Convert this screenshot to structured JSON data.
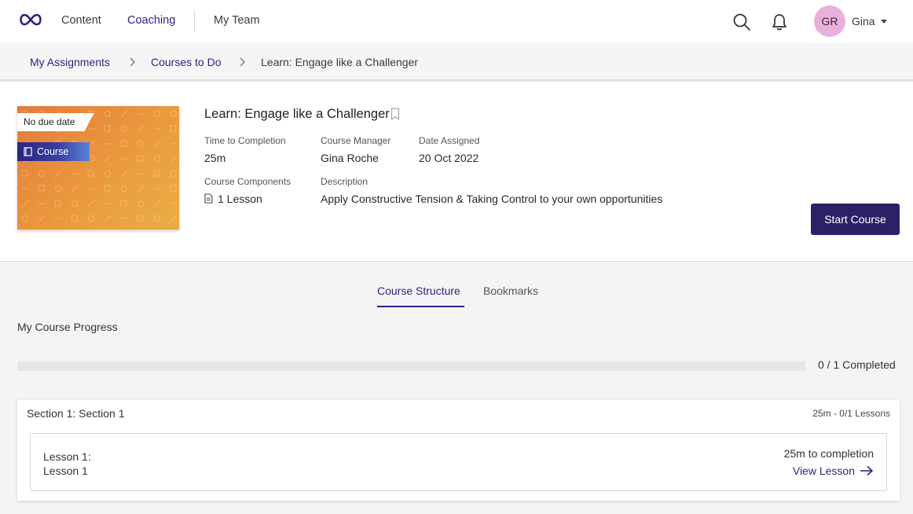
{
  "colors": {
    "brand": "#2c2580",
    "button": "#2c2066",
    "avatar": "#eab0dc"
  },
  "nav": {
    "items": [
      {
        "label": "Content",
        "active": false
      },
      {
        "label": "Coaching",
        "active": true
      },
      {
        "label": "My Team",
        "active": false
      }
    ],
    "icons": [
      "logo-icon",
      "search-icon",
      "bell-icon",
      "caret-down-icon"
    ],
    "user": {
      "initials": "GR",
      "name": "Gina"
    }
  },
  "breadcrumb": [
    "My Assignments",
    "Courses to Do",
    "Learn: Engage like a Challenger"
  ],
  "course": {
    "due_tag": "No due date",
    "type_tag": "Course",
    "title": "Learn: Engage like a Challenger",
    "time_label": "Time to Completion",
    "time_value": "25m",
    "manager_label": "Course Manager",
    "manager_value": "Gina Roche",
    "assigned_label": "Date Assigned",
    "assigned_value": "20 Oct 2022",
    "components_label": "Course Components",
    "components_value": "1 Lesson",
    "description_label": "Description",
    "description_value": "Apply Constructive Tension & Taking Control to your own opportunities",
    "start_button": "Start Course"
  },
  "tabs": [
    {
      "label": "Course Structure",
      "active": true
    },
    {
      "label": "Bookmarks",
      "active": false
    }
  ],
  "progress": {
    "title": "My Course Progress",
    "completed": 0,
    "total": 1,
    "text": "0 / 1 Completed"
  },
  "sections": [
    {
      "title": "Section 1: Section 1",
      "meta": "25m - 0/1 Lessons",
      "lessons": [
        {
          "line1": "Lesson 1:",
          "line2": "Lesson 1",
          "time": "25m to completion",
          "action": "View Lesson"
        }
      ]
    }
  ]
}
